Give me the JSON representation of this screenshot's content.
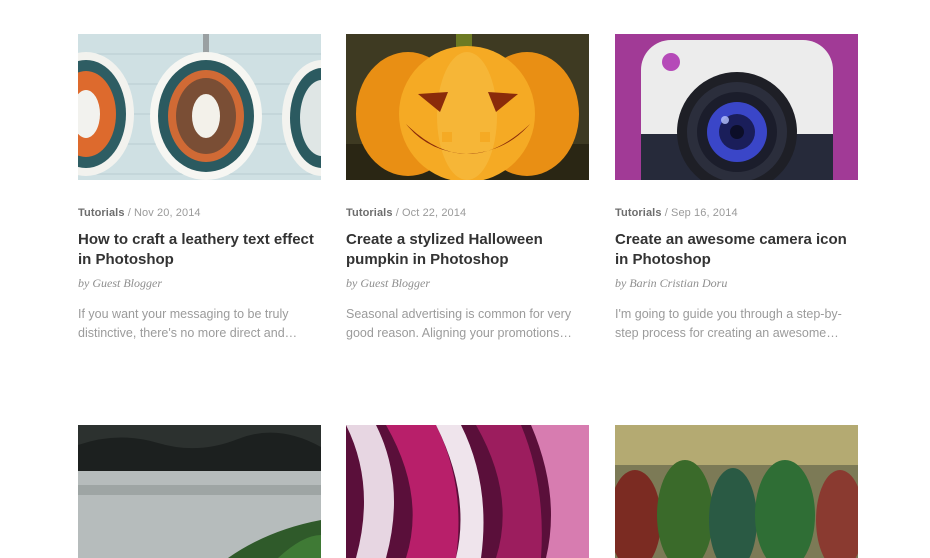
{
  "posts": [
    {
      "category": "Tutorials",
      "date": "/ Nov 20, 2014",
      "title": "How to craft a leathery text effect in Photoshop",
      "author": "by Guest Blogger",
      "excerpt": "If you want your messaging to be truly distinctive, there's no more direct and…"
    },
    {
      "category": "Tutorials",
      "date": "/ Oct 22, 2014",
      "title": "Create a stylized Halloween pumpkin in Photoshop",
      "author": "by Guest Blogger",
      "excerpt": "Seasonal advertising is common for very good reason. Aligning your promotions…"
    },
    {
      "category": "Tutorials",
      "date": "/ Sep 16, 2014",
      "title": "Create an awesome camera icon in Photoshop",
      "author": "by Barin Cristian Doru",
      "excerpt": "I'm going to guide you through a step-by-step process for creating an awesome…"
    }
  ],
  "colors": {
    "title": "#333333",
    "meta": "#9a9a9a",
    "camera_bg": "#a13a96",
    "pumpkin": "#f3a21e"
  }
}
